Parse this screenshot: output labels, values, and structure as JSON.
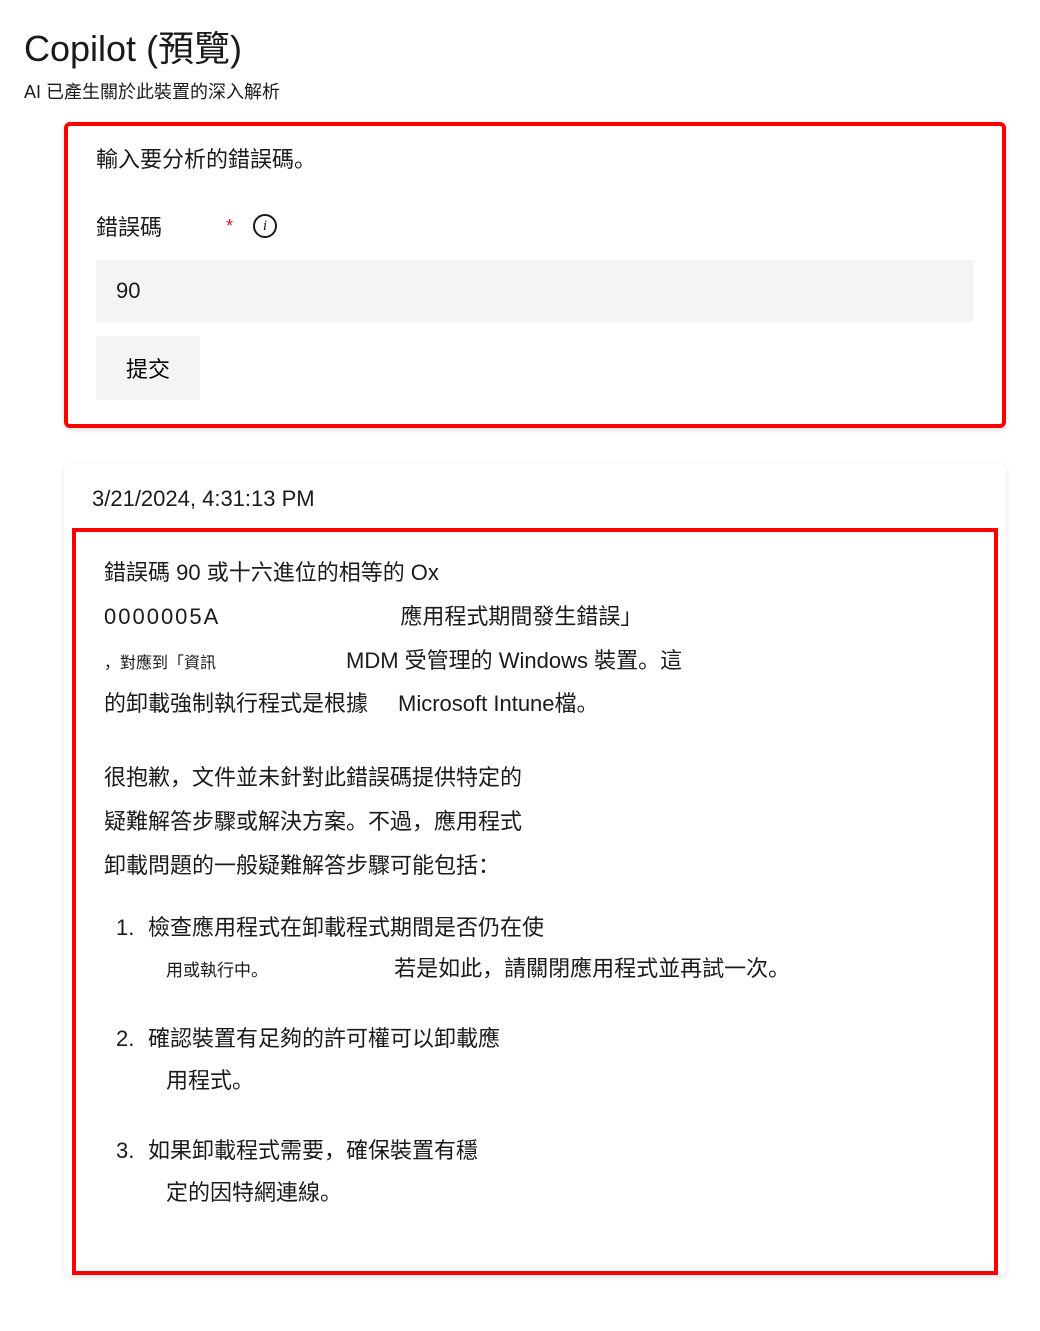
{
  "header": {
    "title": "Copilot (預覽)",
    "subtitle": "AI 已產生關於此裝置的深入解析"
  },
  "form": {
    "prompt": "輸入要分析的錯誤碼。",
    "field_label": "錯誤碼",
    "required_mark": "*",
    "info_icon": "i",
    "input_value": "90",
    "submit_label": "提交"
  },
  "response": {
    "timestamp": "3/21/2024, 4:31:13 PM",
    "line1": "錯誤碼 90 或十六進位的相等的 Ox",
    "line2_code": "0000005A",
    "line2_right": "應用程式期間發生錯誤」",
    "line3_left": "，對應到「資訊",
    "line3_right": " MDM 受管理的 Windows 裝置。這",
    "line4_left": "的卸載強制執行程式是根據",
    "line4_right": "Microsoft Intune檔。",
    "para2_line1": "很抱歉，文件並未針對此錯誤碼提供特定的",
    "para2_line2": "疑難解答步驟或解決方案。不過，應用程式",
    "para2_line3": "卸載問題的一般疑難解答步驟可能包括：",
    "steps": [
      {
        "main": "檢查應用程式在卸載程式期間是否仍在使",
        "cont_small": "用或執行中。",
        "cont_right": "若是如此，請關閉應用程式並再試一次。"
      },
      {
        "main": "確認裝置有足夠的許可權可以卸載應",
        "cont": "用程式。"
      },
      {
        "main": "如果卸載程式需要，確保裝置有穩",
        "cont": "定的因特網連線。"
      }
    ]
  }
}
